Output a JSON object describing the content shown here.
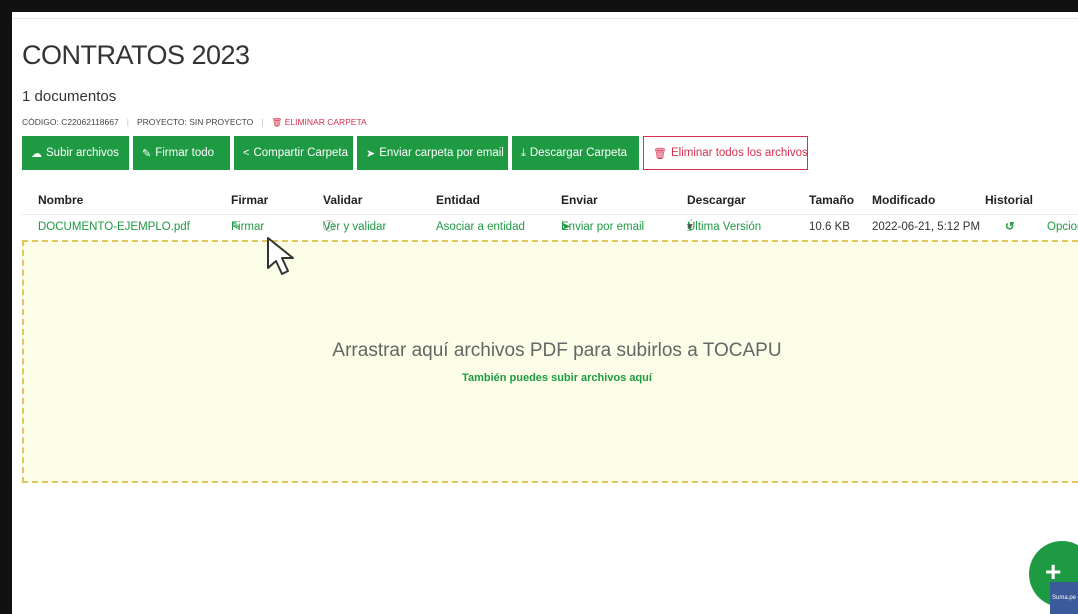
{
  "header": {
    "title": "CONTRATOS 2023",
    "doc_count": "1 documentos",
    "code": "CÓDIGO: C22062118667",
    "project": "PROYECTO: SIN PROYECTO",
    "delete_folder": "ELIMINAR CARPETA"
  },
  "actions": [
    {
      "label": "Subir archivos",
      "icon": "cloud-upload-icon"
    },
    {
      "label": "Firmar todo",
      "icon": "edit-icon"
    },
    {
      "label": "Compartir Carpeta",
      "icon": "share-icon"
    },
    {
      "label": "Enviar carpeta por email",
      "icon": "paper-plane-icon"
    },
    {
      "label": "Descargar Carpeta",
      "icon": "download-icon"
    },
    {
      "label": "Eliminar todos los archivos",
      "icon": "trash-icon"
    }
  ],
  "table": {
    "columns": [
      "Nombre",
      "Firmar",
      "Validar",
      "Entidad",
      "Enviar",
      "Descargar",
      "Tamaño",
      "Modificado",
      "Historial"
    ],
    "row": {
      "name": "DOCUMENTO-EJEMPLO.pdf",
      "sign": "Firmar",
      "validate": "Ver y validar",
      "entity": "Asociar a entidad",
      "send": "Enviar por email",
      "download": "Última Versión",
      "size": "10.6 KB",
      "modified": "2022-06-21, 5:12 PM",
      "options": "Opcion"
    }
  },
  "dropzone": {
    "main": "Arrastrar aquí archivos PDF para subirlos a TOCAPU",
    "sub": "También puedes subir archivos aquí"
  },
  "corner_badge": "Suma.pe",
  "colors": {
    "accent": "#1e9a43",
    "danger": "#d6304d",
    "dropzone_bg": "#fbfde6",
    "dropzone_border": "#e2c55c"
  }
}
